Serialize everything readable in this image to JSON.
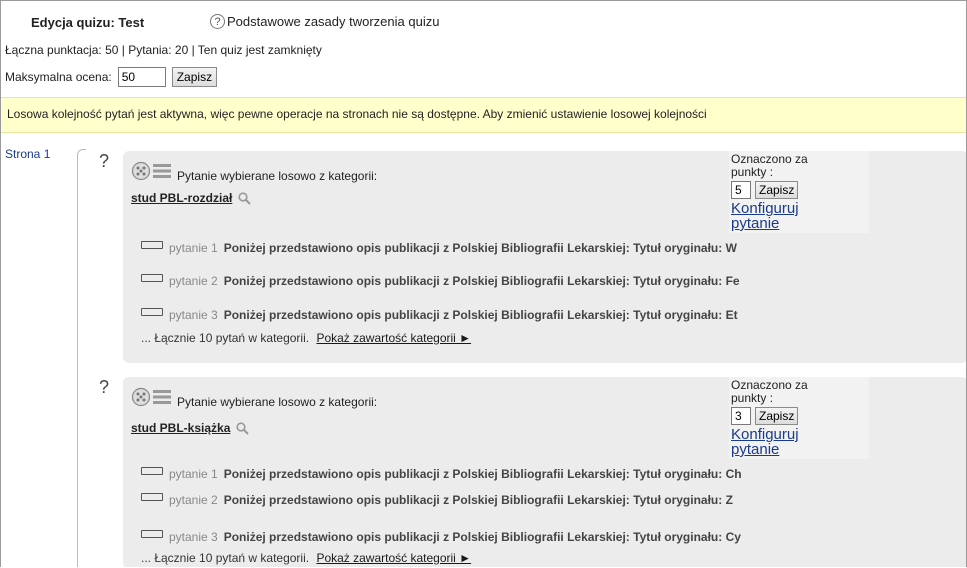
{
  "header": {
    "title": "Edycja quizu: Test",
    "help_link": "Podstawowe zasady tworzenia quizu",
    "help_icon": "question-circle-icon",
    "summary": "Łączna punktacja: 50 | Pytania: 20 | Ten quiz jest zamknięty"
  },
  "max_grade": {
    "label": "Maksymalna ocena:",
    "value": "50",
    "save_label": "Zapisz"
  },
  "notice": "Losowa kolejność pytań jest aktywna, więc pewne operacje na stronach nie są dostępne. Aby zmienić ustawienie losowej kolejności",
  "page": {
    "label": "Strona 1"
  },
  "slots": [
    {
      "qmark": "?",
      "heading": "Pytanie wybierane losowo z kategorii:",
      "category": "stud PBL-rozdział",
      "marks_label": "Oznaczono za punkty :",
      "marks_value": "5",
      "save_label": "Zapisz",
      "configure_label": "Konfiguruj pytanie",
      "questions": [
        {
          "num": "pytanie 1",
          "text": "Poniżej przedstawiono opis publikacji z Polskiej Bibliografii Lekarskiej: Tytuł oryginału: W"
        },
        {
          "num": "pytanie 2",
          "text": "Poniżej przedstawiono opis publikacji z Polskiej Bibliografii Lekarskiej: Tytuł oryginału: Fe"
        },
        {
          "num": "pytanie 3",
          "text": "Poniżej przedstawiono opis publikacji z Polskiej Bibliografii Lekarskiej: Tytuł oryginału: Et"
        }
      ],
      "total_text": "... Łącznie 10 pytań w kategorii.",
      "show_link": "Pokaż zawartość kategorii ►"
    },
    {
      "qmark": "?",
      "heading": "Pytanie wybierane losowo z kategorii:",
      "category": "stud PBL-książka",
      "marks_label": "Oznaczono za punkty :",
      "marks_value": "3",
      "save_label": "Zapisz",
      "configure_label": "Konfiguruj pytanie",
      "questions": [
        {
          "num": "pytanie 1",
          "text": "Poniżej przedstawiono opis publikacji z Polskiej Bibliografii Lekarskiej: Tytuł oryginału: Ch"
        },
        {
          "num": "pytanie 2",
          "text": "Poniżej przedstawiono opis publikacji z Polskiej Bibliografii Lekarskiej:  Tytuł oryginału: Z"
        },
        {
          "num": "pytanie 3",
          "text": "Poniżej przedstawiono opis publikacji z Polskiej Bibliografii Lekarskiej: Tytuł oryginału: Cy"
        }
      ],
      "total_text": "... Łącznie 10 pytań w kategorii.",
      "show_link": "Pokaż zawartość kategorii ►"
    }
  ]
}
